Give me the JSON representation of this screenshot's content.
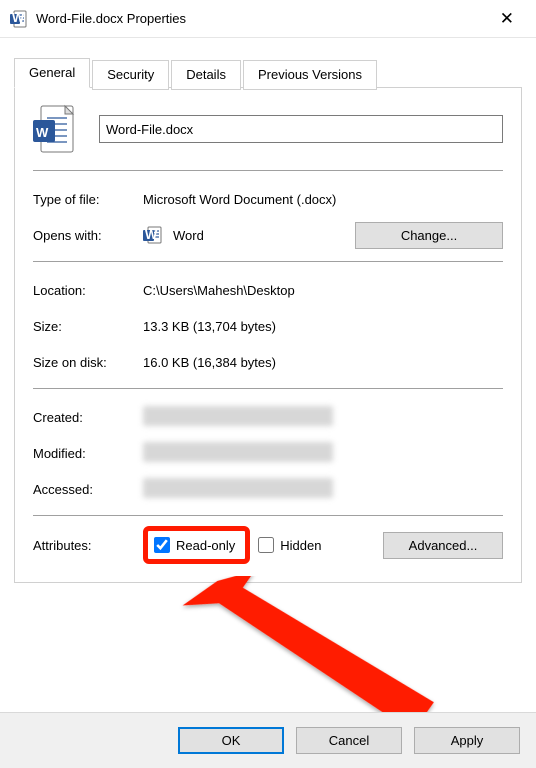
{
  "titlebar": {
    "title": "Word-File.docx Properties"
  },
  "tabs": {
    "items": [
      {
        "label": "General",
        "active": true
      },
      {
        "label": "Security",
        "active": false
      },
      {
        "label": "Details",
        "active": false
      },
      {
        "label": "Previous Versions",
        "active": false
      }
    ]
  },
  "file": {
    "name": "Word-File.docx"
  },
  "fields": {
    "typeOfFileLabel": "Type of file:",
    "typeOfFileValue": "Microsoft Word Document (.docx)",
    "opensWithLabel": "Opens with:",
    "opensWithValue": "Word",
    "changeButton": "Change...",
    "locationLabel": "Location:",
    "locationValue": "C:\\Users\\Mahesh\\Desktop",
    "sizeLabel": "Size:",
    "sizeValue": "13.3 KB (13,704 bytes)",
    "sizeOnDiskLabel": "Size on disk:",
    "sizeOnDiskValue": "16.0 KB (16,384 bytes)",
    "createdLabel": "Created:",
    "modifiedLabel": "Modified:",
    "accessedLabel": "Accessed:",
    "attributesLabel": "Attributes:",
    "readOnlyLabel": "Read-only",
    "hiddenLabel": "Hidden",
    "advancedButton": "Advanced..."
  },
  "attributes": {
    "readOnly": true,
    "hidden": false
  },
  "actions": {
    "ok": "OK",
    "cancel": "Cancel",
    "apply": "Apply"
  }
}
